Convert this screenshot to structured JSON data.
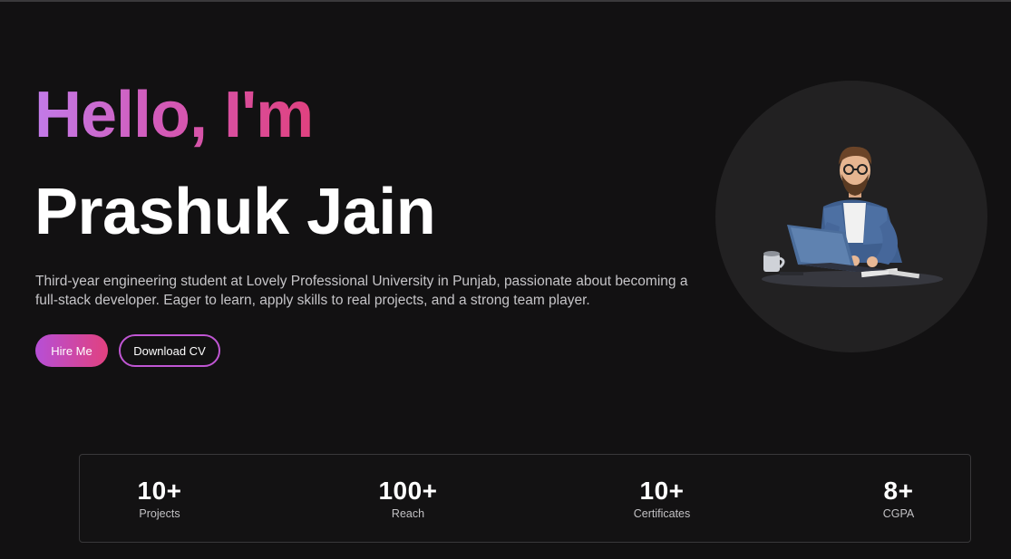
{
  "hero": {
    "greeting": "Hello, I'm",
    "name": "Prashuk Jain",
    "bio": "Third-year engineering student at Lovely Professional University in Punjab, passionate about becoming a full-stack developer. Eager to learn, apply skills to real projects, and a strong team player.",
    "hire_label": "Hire Me",
    "cv_label": "Download CV",
    "avatar_icon": "developer-illustration-icon"
  },
  "stats": [
    {
      "value": "10+",
      "label": "Projects"
    },
    {
      "value": "100+",
      "label": "Reach"
    },
    {
      "value": "10+",
      "label": "Certificates"
    },
    {
      "value": "8+",
      "label": "CGPA"
    }
  ],
  "colors": {
    "background": "#121112",
    "accent_start": "#c27be9",
    "accent_end": "#e0417f",
    "button_border": "#c056d3",
    "card_border": "#39383a"
  }
}
